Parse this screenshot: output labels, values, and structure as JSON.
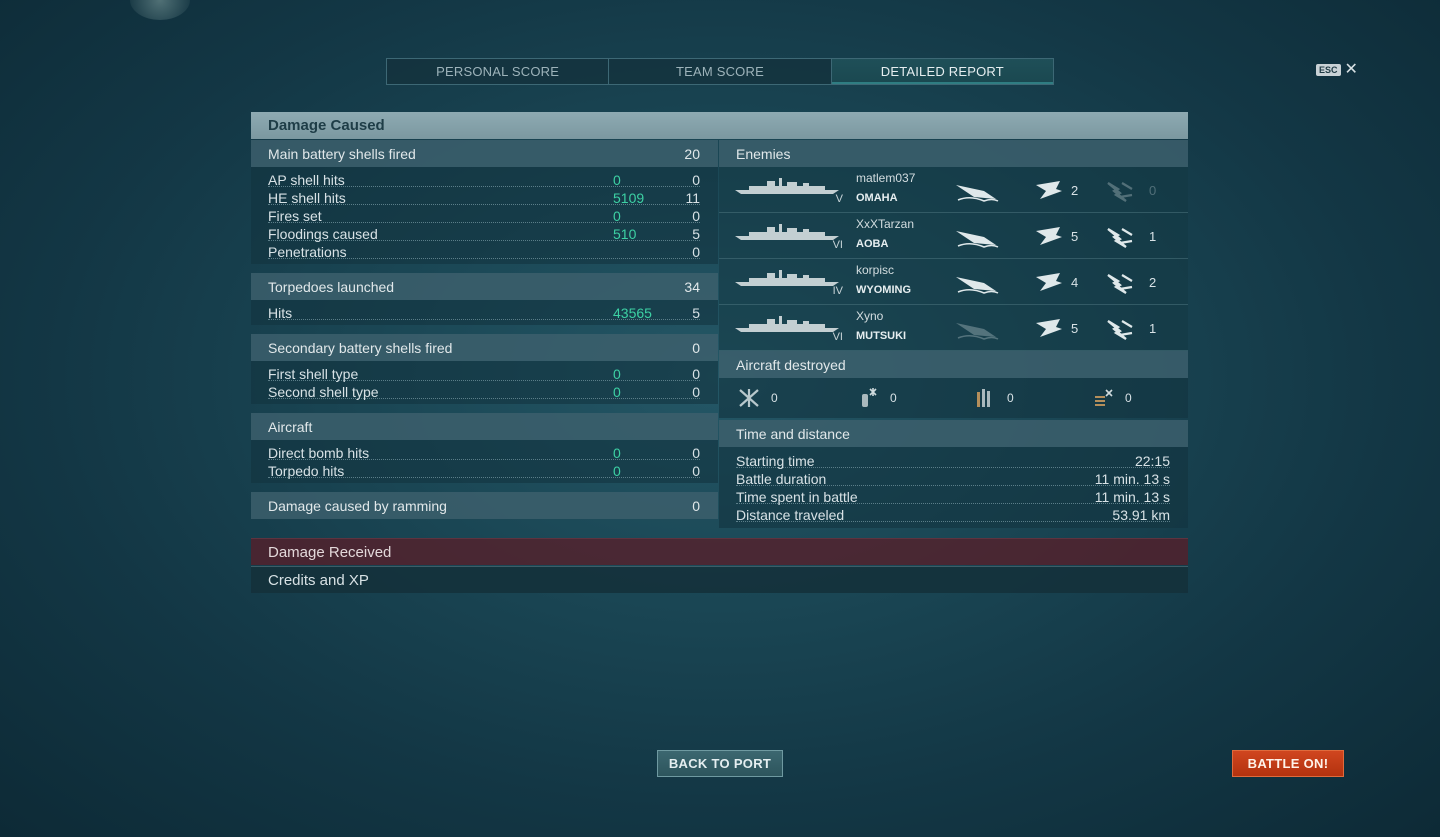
{
  "tabs": [
    {
      "label": "PERSONAL SCORE"
    },
    {
      "label": "TEAM SCORE"
    },
    {
      "label": "DETAILED REPORT"
    }
  ],
  "esc": {
    "key": "ESC",
    "close": "✕"
  },
  "damage_caused": {
    "title": "Damage Caused",
    "main_battery": {
      "label": "Main battery shells fired",
      "value": "20",
      "rows": [
        {
          "label": "AP shell hits",
          "damage": "0",
          "count": "0"
        },
        {
          "label": "HE shell hits",
          "damage": "5109",
          "count": "11"
        },
        {
          "label": "Fires set",
          "damage": "0",
          "count": "0"
        },
        {
          "label": "Floodings caused",
          "damage": "510",
          "count": "5"
        },
        {
          "label": "Penetrations",
          "damage": "",
          "count": "0"
        }
      ]
    },
    "torpedoes": {
      "label": "Torpedoes launched",
      "value": "34",
      "rows": [
        {
          "label": "Hits",
          "damage": "43565",
          "count": "5"
        }
      ]
    },
    "secondary": {
      "label": "Secondary battery shells fired",
      "value": "0",
      "rows": [
        {
          "label": "First shell type",
          "damage": "0",
          "count": "0"
        },
        {
          "label": "Second shell type",
          "damage": "0",
          "count": "0"
        }
      ]
    },
    "aircraft": {
      "label": "Aircraft",
      "rows": [
        {
          "label": "Direct bomb hits",
          "damage": "0",
          "count": "0"
        },
        {
          "label": "Torpedo hits",
          "damage": "0",
          "count": "0"
        }
      ]
    },
    "ramming": {
      "label": "Damage caused by ramming",
      "value": "0"
    }
  },
  "enemies": {
    "title": "Enemies",
    "list": [
      {
        "player": "matlem037",
        "ship": "OMAHA",
        "tier": "V",
        "hits_a": "2",
        "hits_b": "0",
        "sunk": true,
        "b_dim": true
      },
      {
        "player": "XxXTarzan",
        "ship": "AOBA",
        "tier": "VI",
        "hits_a": "5",
        "hits_b": "1",
        "sunk": true,
        "b_dim": false
      },
      {
        "player": "korpisc",
        "ship": "WYOMING",
        "tier": "IV",
        "hits_a": "4",
        "hits_b": "2",
        "sunk": true,
        "b_dim": false
      },
      {
        "player": "Xyno",
        "ship": "MUTSUKI",
        "tier": "VI",
        "hits_a": "5",
        "hits_b": "1",
        "sunk": false,
        "b_dim": false
      }
    ]
  },
  "aircraft_destroyed": {
    "title": "Aircraft destroyed",
    "items": [
      {
        "icon": "fighter-plane-icon",
        "value": "0"
      },
      {
        "icon": "hit-shell-icon",
        "value": "0"
      },
      {
        "icon": "aa-gun-icon",
        "value": "0"
      },
      {
        "icon": "secondary-aa-icon",
        "value": "0"
      }
    ]
  },
  "time_distance": {
    "title": "Time and distance",
    "rows": [
      {
        "label": "Starting time",
        "value": "22:15"
      },
      {
        "label": "Battle duration",
        "value": "11 min. 13 s"
      },
      {
        "label": "Time spent in battle",
        "value": "11 min. 13 s"
      },
      {
        "label": "Distance traveled",
        "value": "53.91 km"
      }
    ]
  },
  "damage_received": {
    "title": "Damage Received"
  },
  "credits_xp": {
    "title": "Credits and XP"
  },
  "buttons": {
    "back": "BACK TO PORT",
    "battle": "BATTLE ON!"
  }
}
